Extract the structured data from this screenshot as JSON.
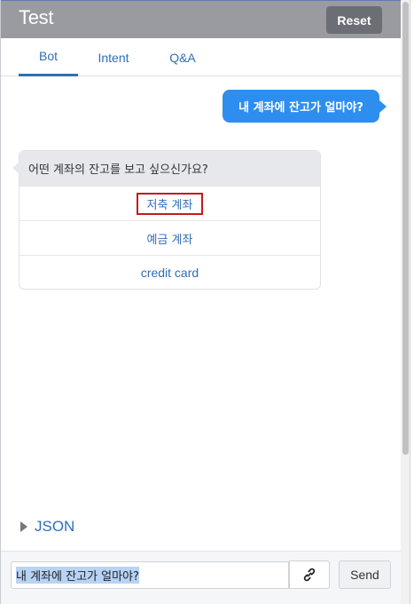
{
  "header": {
    "title": "Test",
    "reset_label": "Reset"
  },
  "tabs": [
    {
      "label": "Bot",
      "active": true
    },
    {
      "label": "Intent",
      "active": false
    },
    {
      "label": "Q&A",
      "active": false
    }
  ],
  "conversation": {
    "user_message": "내 계좌에 잔고가 얼마야?",
    "bot_question": "어떤 계좌의 잔고를 보고 싶으신가요?",
    "options": [
      {
        "label": "저축 계좌",
        "highlighted": true
      },
      {
        "label": "예금 계좌",
        "highlighted": false
      },
      {
        "label": "credit card",
        "highlighted": false
      }
    ]
  },
  "json_toggle": {
    "label": "JSON",
    "icon": "caret-right-icon"
  },
  "composer": {
    "input_value": "내 계좌에 잔고가 얼마야?",
    "link_icon": "link-icon",
    "send_label": "Send"
  },
  "colors": {
    "header_bg": "#999ba1",
    "accent": "#2f6fb6",
    "user_bubble": "#2e8ef0",
    "highlight_box": "#c21c1c"
  }
}
